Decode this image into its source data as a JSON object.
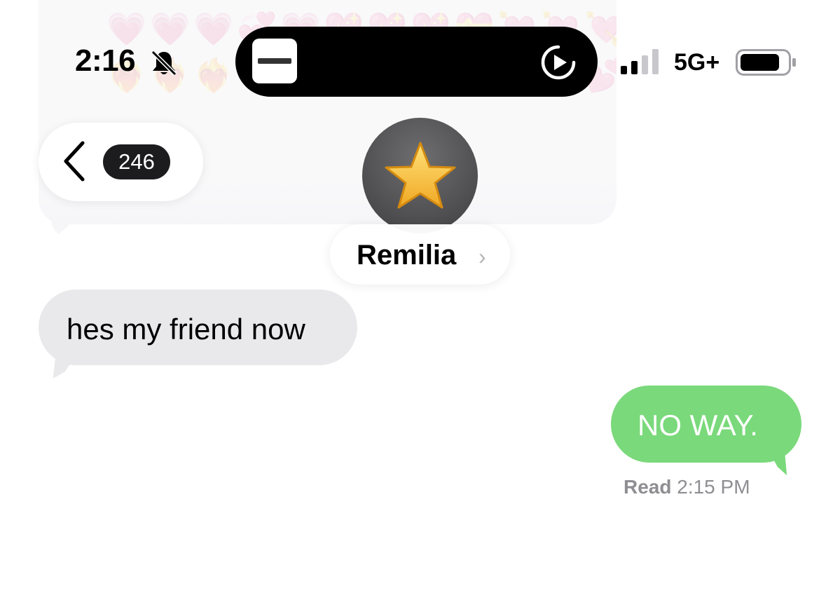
{
  "status_bar": {
    "time": "2:16",
    "network": "5G+",
    "icons": [
      "bell-slash-icon",
      "signal-icon",
      "battery-icon"
    ]
  },
  "dynamic_island": {
    "now_playing_icon": "album-art",
    "control_icon": "play-ring-icon"
  },
  "nav": {
    "back_icon": "chevron-left-icon",
    "unread_count": "246"
  },
  "contact": {
    "avatar_emoji": "⭐",
    "name": "Remilia",
    "chevron": "›"
  },
  "messages": [
    {
      "direction": "incoming",
      "text": "hes my friend now"
    },
    {
      "direction": "outgoing",
      "text": "NO WAY."
    }
  ],
  "read_receipt": {
    "label": "Read",
    "time": "2:15 PM"
  },
  "background_sticker": {
    "emojis": [
      "🩵",
      "🩵",
      "🩵",
      "💜",
      "🩷",
      "🤍",
      "🤍",
      "🤍",
      "🤍",
      "💚",
      "💚",
      "🤍",
      "💗",
      "💗",
      "💗",
      "💞",
      "💗",
      "💖",
      "💖",
      "💖",
      "💝",
      "💘",
      "💘",
      "💘",
      "❤️‍🔥",
      "❤️‍🔥",
      "❤️‍🔥",
      "❤️‍🩹",
      "❣️",
      "❣️",
      "❣️",
      "💕",
      "💕",
      "💕",
      "💕",
      "💕"
    ]
  },
  "colors": {
    "incoming_bubble": "#e9e9eb",
    "outgoing_bubble": "#7ad97b",
    "badge": "#1c1c1e",
    "secondary_text": "#8e8e93"
  }
}
